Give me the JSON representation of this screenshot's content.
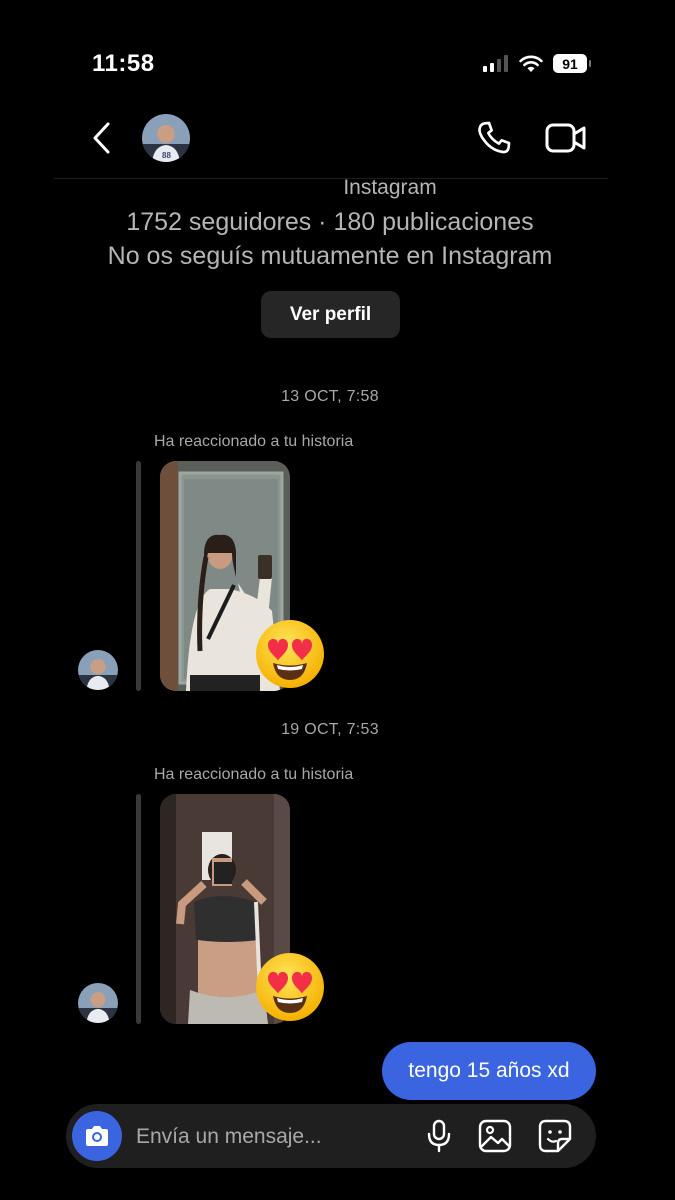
{
  "status_bar": {
    "time": "11:58",
    "battery": "91"
  },
  "header": {
    "back_icon": "chevron-left-icon",
    "call_icon": "phone-icon",
    "video_icon": "video-camera-icon"
  },
  "profile": {
    "network": "Instagram",
    "stats": "1752 seguidores · 180 publicaciones",
    "mutual": "No os seguís mutuamente en Instagram",
    "view_profile_label": "Ver perfil"
  },
  "messages": [
    {
      "timestamp": "13 OCT, 7:58",
      "label": "Ha reaccionado a tu historia",
      "reaction": "😍"
    },
    {
      "timestamp": "19 OCT, 7:53",
      "label": "Ha reaccionado a tu historia",
      "reaction": "😍"
    }
  ],
  "sent": {
    "text": "tengo 15 años xd"
  },
  "composer": {
    "placeholder": "Envía un mensaje...",
    "icons": [
      "camera-icon",
      "microphone-icon",
      "gallery-icon",
      "sticker-icon"
    ]
  },
  "colors": {
    "accent": "#3a64e0",
    "background": "#000000",
    "secondary_text": "#a8a8a8"
  }
}
